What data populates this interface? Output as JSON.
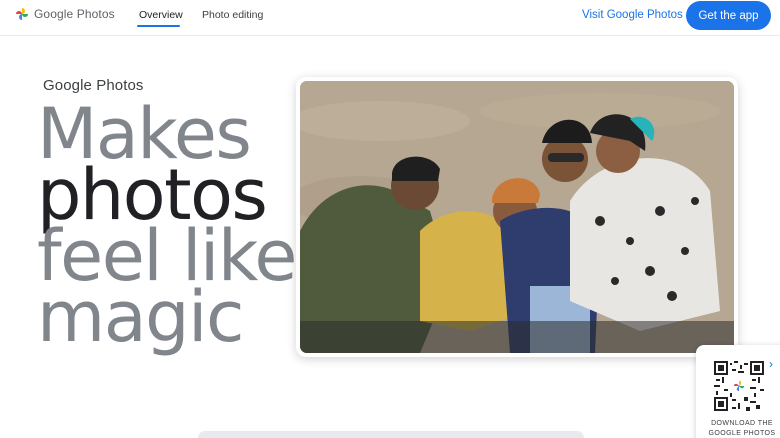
{
  "header": {
    "logo_text": "Google Photos",
    "nav": [
      {
        "label": "Overview",
        "active": true
      },
      {
        "label": "Photo editing",
        "active": false
      }
    ],
    "visit_link": "Visit Google Photos",
    "cta_label": "Get the app"
  },
  "hero": {
    "brand": "Google Photos",
    "headline": [
      "Makes",
      "photos",
      "feel like",
      "magic"
    ]
  },
  "qr": {
    "caption_line1": "DOWNLOAD THE",
    "caption_line2": "GOOGLE PHOTOS"
  },
  "colors": {
    "accent": "#1a73e8",
    "headline_gray": "#80868b",
    "headline_dark": "#202124"
  }
}
